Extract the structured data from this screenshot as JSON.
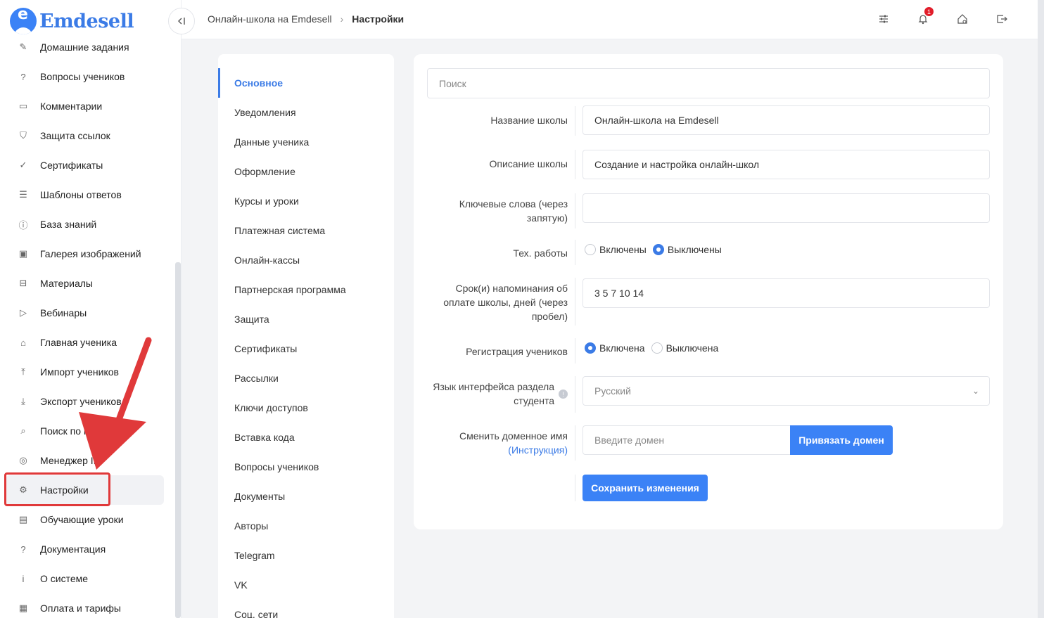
{
  "brand": {
    "name": "Emdesell"
  },
  "sidebar": {
    "items": [
      {
        "label": "Домашние задания",
        "icon": "pencil-icon",
        "glyph": "✎"
      },
      {
        "label": "Вопросы учеников",
        "icon": "question-circle-icon",
        "glyph": "?"
      },
      {
        "label": "Комментарии",
        "icon": "comment-icon",
        "glyph": "▭"
      },
      {
        "label": "Защита ссылок",
        "icon": "shield-icon",
        "glyph": "⛉"
      },
      {
        "label": "Сертификаты",
        "icon": "check-circle-icon",
        "glyph": "✓"
      },
      {
        "label": "Шаблоны ответов",
        "icon": "list-icon",
        "glyph": "☰"
      },
      {
        "label": "База знаний",
        "icon": "info-circle-icon",
        "glyph": "ⓘ"
      },
      {
        "label": "Галерея изображений",
        "icon": "image-icon",
        "glyph": "▣"
      },
      {
        "label": "Материалы",
        "icon": "briefcase-icon",
        "glyph": "⊟"
      },
      {
        "label": "Вебинары",
        "icon": "play-icon",
        "glyph": "▷"
      },
      {
        "label": "Главная ученика",
        "icon": "home-icon",
        "glyph": "⌂"
      },
      {
        "label": "Импорт учеников",
        "icon": "upload-icon",
        "glyph": "⤒"
      },
      {
        "label": "Экспорт учеников",
        "icon": "download-icon",
        "glyph": "⤓"
      },
      {
        "label": "Поиск по кл",
        "icon": "search-icon",
        "glyph": "⌕"
      },
      {
        "label": "Менеджер IP",
        "icon": "target-icon",
        "glyph": "◎"
      },
      {
        "label": "Настройки",
        "icon": "gear-icon",
        "glyph": "⚙",
        "active": true
      },
      {
        "label": "Обучающие уроки",
        "icon": "film-icon",
        "glyph": "▤"
      },
      {
        "label": "Документация",
        "icon": "question-square-icon",
        "glyph": "?"
      },
      {
        "label": "О системе",
        "icon": "info-square-icon",
        "glyph": "i"
      },
      {
        "label": "Оплата и тарифы",
        "icon": "receipt-icon",
        "glyph": "▦"
      }
    ]
  },
  "header": {
    "breadcrumb": [
      "Онлайн-школа на Emdesell",
      "Настройки"
    ],
    "notification_count": "1"
  },
  "settings_nav": {
    "items": [
      "Основное",
      "Уведомления",
      "Данные ученика",
      "Оформление",
      "Курсы и уроки",
      "Платежная система",
      "Онлайн-кассы",
      "Партнерская программа",
      "Защита",
      "Сертификаты",
      "Рассылки",
      "Ключи доступов",
      "Вставка кода",
      "Вопросы учеников",
      "Документы",
      "Авторы",
      "Telegram",
      "VK",
      "Соц. сети"
    ],
    "active": "Основное"
  },
  "form": {
    "search_placeholder": "Поиск",
    "school_name_label": "Название школы",
    "school_name_value": "Онлайн-школа на Emdesell",
    "school_desc_label": "Описание школы",
    "school_desc_value": "Создание и настройка онлайн-школ",
    "keywords_label": "Ключевые слова (через запятую)",
    "keywords_value": "",
    "maintenance_label": "Тех. работы",
    "maintenance_on": "Включены",
    "maintenance_off": "Выключены",
    "maintenance_selected": "off",
    "reminder_label": "Срок(и) напоминания об оплате школы, дней (через пробел)",
    "reminder_value": "3 5 7 10 14",
    "registration_label": "Регистрация учеников",
    "registration_on": "Включена",
    "registration_off": "Выключена",
    "registration_selected": "on",
    "language_label": "Язык интерфейса раздела студента",
    "language_value": "Русский",
    "domain_label": "Сменить доменное имя",
    "domain_link": "(Инструкция)",
    "domain_placeholder": "Введите домен",
    "domain_button": "Привязать домен",
    "save_button": "Сохранить изменения"
  },
  "colors": {
    "accent": "#3b82f6",
    "annotation": "#e0393a"
  }
}
